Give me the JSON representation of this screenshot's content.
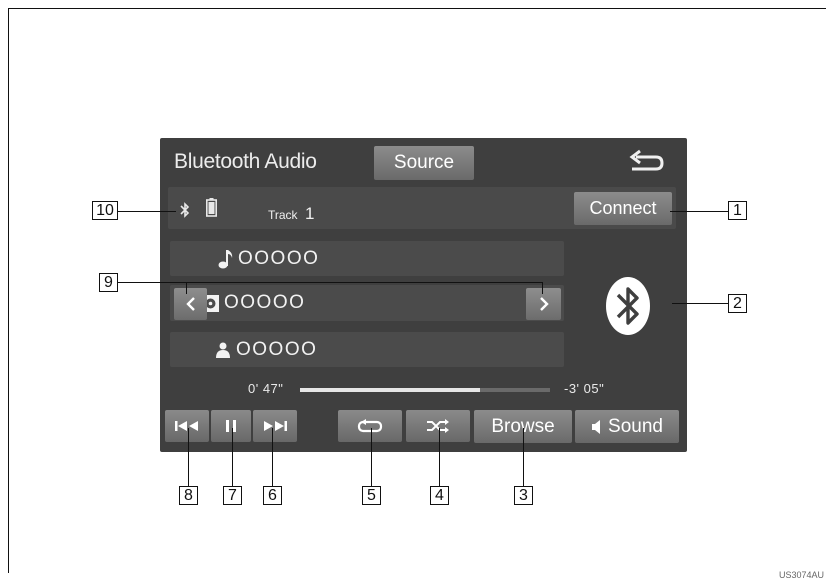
{
  "screen": {
    "title": "Bluetooth Audio",
    "source_label": "Source",
    "back_icon": "back-arrow-icon",
    "connect_label": "Connect",
    "track_prefix": "Track",
    "track_number": "1",
    "rows": [
      {
        "icon": "music-note-icon",
        "text": "OOOOO"
      },
      {
        "icon": "album-icon",
        "text": "OOOOO"
      },
      {
        "icon": "artist-icon",
        "text": "OOOOO"
      }
    ],
    "elapsed": "0' 47\"",
    "remaining": "-3' 05\"",
    "progress": 0.72,
    "controls": {
      "browse_label": "Browse",
      "sound_label": "Sound"
    }
  },
  "callouts": [
    "1",
    "2",
    "3",
    "4",
    "5",
    "6",
    "7",
    "8",
    "9",
    "10"
  ],
  "image_code": "US3074AU"
}
